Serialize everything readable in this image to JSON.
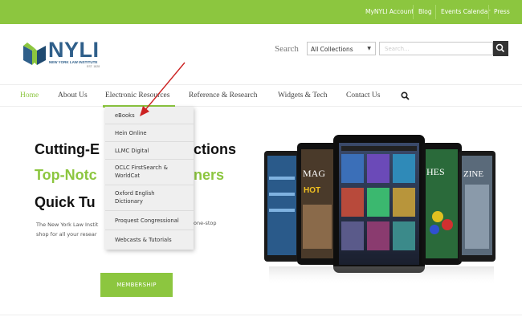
{
  "topbar": {
    "links": [
      "MyNYLI Account",
      "Blog",
      "Events Calendar",
      "Press"
    ]
  },
  "logo": {
    "name": "NYLI",
    "subtitle": "NEW YORK LAW INSTITUTE",
    "est": "EST. 1828"
  },
  "search": {
    "label": "Search",
    "collection_selected": "All Collections",
    "placeholder": "Search..."
  },
  "nav": {
    "items": [
      "Home",
      "About Us",
      "Electronic Resources",
      "Reference & Research",
      "Widgets & Tech",
      "Contact Us"
    ]
  },
  "dropdown": {
    "items": [
      "eBooks",
      "Hein Online",
      "LLMC Digital",
      "OCLC FirstSearch & WorldCat",
      "Oxford English Dictionary",
      "Proquest Congressional",
      "Webcasts & Tutorials"
    ]
  },
  "hero": {
    "line1_left": "Cutting-E",
    "line1_right": "ctions",
    "line2_left": "Top-Notc",
    "line2_right": "ners",
    "line3": "Quick Tu",
    "desc_line1": "The New York Law Instit",
    "desc_line2": "shop for all your resear",
    "desc_right": "one-stop"
  },
  "membership": {
    "label": "MEMBERSHIP"
  },
  "colors": {
    "brand_green": "#8cc63f",
    "logo_blue": "#2f5f8a",
    "annotation_red": "#cc2222"
  }
}
